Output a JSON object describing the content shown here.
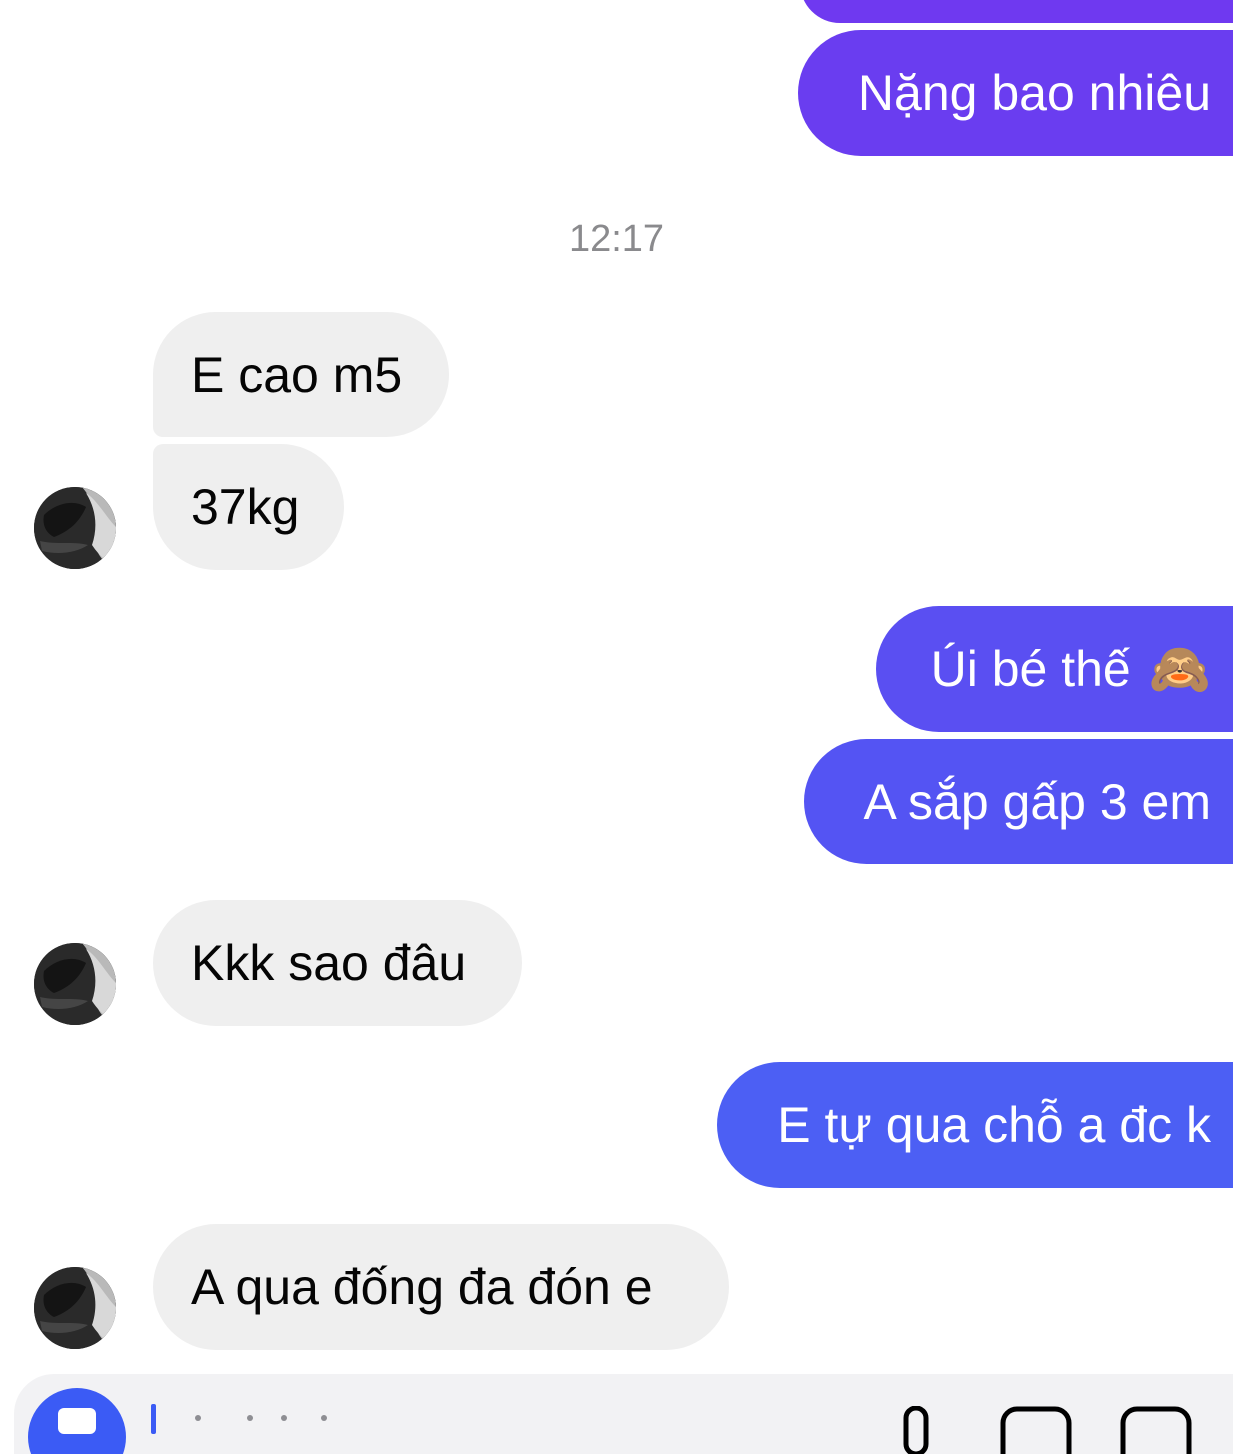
{
  "conversation": {
    "timestamp": "12:17",
    "messages": [
      {
        "id": "m1",
        "direction": "outgoing",
        "text": "Nặng bao nhiêu",
        "color": "#6a3df0"
      },
      {
        "id": "m2",
        "direction": "incoming",
        "text": "E cao m5"
      },
      {
        "id": "m3",
        "direction": "incoming",
        "text": "37kg"
      },
      {
        "id": "m4",
        "direction": "outgoing",
        "text": "Úi bé thế",
        "emoji": "🙈",
        "color": "#5a4ff2"
      },
      {
        "id": "m5",
        "direction": "outgoing",
        "text": "A sắp gấp 3 em",
        "color": "#5454f3"
      },
      {
        "id": "m6",
        "direction": "incoming",
        "text": "Kkk sao đâu"
      },
      {
        "id": "m7",
        "direction": "outgoing",
        "text": "E tự qua chỗ a đc k",
        "color": "#4c5ff4"
      },
      {
        "id": "m8",
        "direction": "incoming",
        "text": "A qua đống đa đón e"
      }
    ],
    "top_partial_bubble_color": "#6f39f0"
  },
  "colors": {
    "incoming_bubble": "#efefef",
    "composer_background": "#f2f2f4",
    "accent_blue": "#3b5bf5"
  },
  "icons": {
    "avatar": "contact-avatar",
    "camera": "camera-icon",
    "mic": "microphone-icon",
    "image": "image-icon",
    "sticker": "sticker-icon"
  }
}
